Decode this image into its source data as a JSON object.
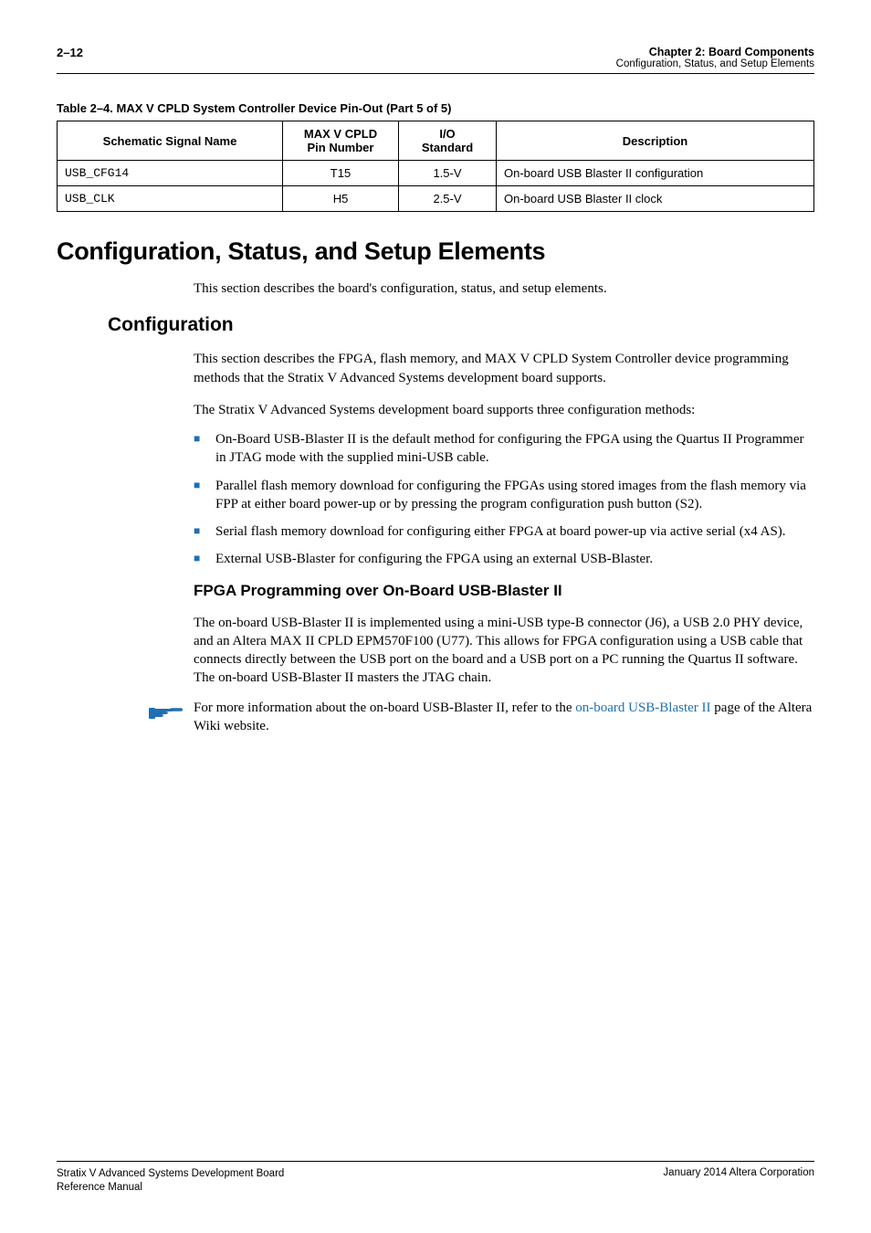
{
  "header": {
    "page_label": "2–12",
    "chapter_line": "Chapter 2: Board Components",
    "sub_line": "Configuration, Status, and Setup Elements"
  },
  "table": {
    "caption": "Table 2–4. MAX V CPLD System Controller Device Pin-Out  (Part 5 of 5)",
    "head": {
      "c0": "Schematic Signal Name",
      "c1_l1": "MAX V CPLD",
      "c1_l2": "Pin Number",
      "c2_l1": "I/O",
      "c2_l2": "Standard",
      "c3": "Description"
    },
    "rows": [
      {
        "sig": "USB_CFG14",
        "pin": "T15",
        "std": "1.5-V",
        "desc": "On-board USB Blaster II configuration"
      },
      {
        "sig": "USB_CLK",
        "pin": "H5",
        "std": "2.5-V",
        "desc": "On-board USB Blaster II clock"
      }
    ]
  },
  "section": {
    "h1": "Configuration, Status, and Setup Elements",
    "p1": "This section describes the board's configuration, status, and setup elements.",
    "h2": "Configuration",
    "p2": "This section describes the FPGA, flash memory, and MAX V CPLD System Controller device programming methods that the Stratix V Advanced Systems development board supports.",
    "p3": "The Stratix V Advanced Systems development board supports three configuration methods:",
    "bullets": [
      "On-Board USB-Blaster II is the default method for configuring the FPGA using the Quartus II Programmer in JTAG mode with the supplied mini-USB cable.",
      "Parallel flash memory download for configuring the FPGAs using stored images from the flash memory via FPP at either board power-up or by pressing the program configuration push button (S2).",
      "Serial flash memory download for configuring either FPGA at board power-up via active serial (x4 AS).",
      "External USB-Blaster for configuring the FPGA using an external USB-Blaster."
    ],
    "h3": "FPGA Programming over On-Board USB-Blaster II",
    "p4": "The on-board USB-Blaster II is implemented using a mini-USB type-B connector (J6), a USB 2.0 PHY device, and an Altera MAX II CPLD EPM570F100 (U77). This allows for FPGA configuration using a USB cable that connects directly between the USB port on the board and a USB port on a PC running the Quartus II software. The on-board USB-Blaster II masters the JTAG chain.",
    "note_pre": "For more information about the on-board USB-Blaster II, refer to the ",
    "note_link": "on-board USB-Blaster II",
    "note_post": " page of the Altera Wiki website."
  },
  "footer": {
    "left_l1": "Stratix V Advanced Systems Development Board",
    "left_l2": "Reference Manual",
    "right": "January 2014   Altera Corporation"
  }
}
